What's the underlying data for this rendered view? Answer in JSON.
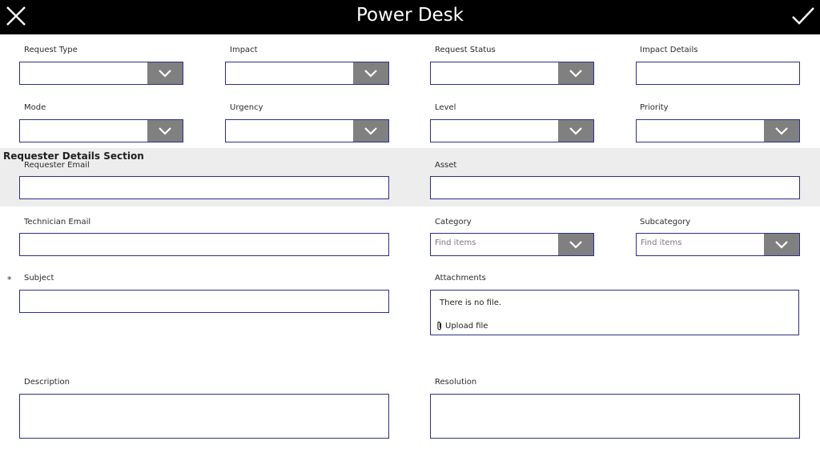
{
  "header": {
    "title": "Power Desk"
  },
  "section": {
    "title": "Requester Details Section"
  },
  "labels": {
    "request_type": "Request Type",
    "impact": "Impact",
    "request_status": "Request Status",
    "impact_details": "Impact Details",
    "mode": "Mode",
    "urgency": "Urgency",
    "level": "Level",
    "priority": "Priority",
    "requester_email": "Requester Email",
    "asset": "Asset",
    "technician_email": "Technician Email",
    "category": "Category",
    "subcategory": "Subcategory",
    "subject": "Subject",
    "attachments": "Attachments",
    "description": "Description",
    "resolution": "Resolution"
  },
  "required_marker": "*",
  "placeholders": {
    "category": "Find items",
    "subcategory": "Find items"
  },
  "attachments": {
    "empty_text": "There is no file.",
    "upload_label": "Upload file"
  },
  "colors": {
    "header_bg": "#000000",
    "field_border": "#2e2e8a",
    "dropdown_button": "#808080",
    "section_bg": "#ededed"
  }
}
